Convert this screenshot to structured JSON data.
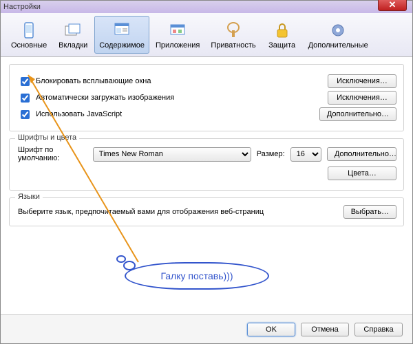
{
  "window": {
    "title": "Настройки"
  },
  "toolbar": {
    "items": [
      {
        "label": "Основные"
      },
      {
        "label": "Вкладки"
      },
      {
        "label": "Содержимое"
      },
      {
        "label": "Приложения"
      },
      {
        "label": "Приватность"
      },
      {
        "label": "Защита"
      },
      {
        "label": "Дополнительные"
      }
    ]
  },
  "popups": {
    "block_label": "Блокировать всплывающие окна",
    "block_checked": true,
    "autoload_label": "Автоматически загружать изображения",
    "autoload_checked": true,
    "js_label": "Использовать JavaScript",
    "js_checked": true,
    "exceptions_btn": "Исключения…",
    "advanced_btn": "Дополнительно…"
  },
  "fonts": {
    "group_title": "Шрифты и цвета",
    "default_font_label": "Шрифт по умолчанию:",
    "default_font": "Times New Roman",
    "size_label": "Размер:",
    "size": "16",
    "advanced_btn": "Дополнительно…",
    "colors_btn": "Цвета…"
  },
  "languages": {
    "group_title": "Языки",
    "desc": "Выберите язык, предпочитаемый вами для отображения веб-страниц",
    "choose_btn": "Выбрать…"
  },
  "annotation": {
    "text": "Галку поставь)))"
  },
  "footer": {
    "ok": "OK",
    "cancel": "Отмена",
    "help": "Справка"
  }
}
